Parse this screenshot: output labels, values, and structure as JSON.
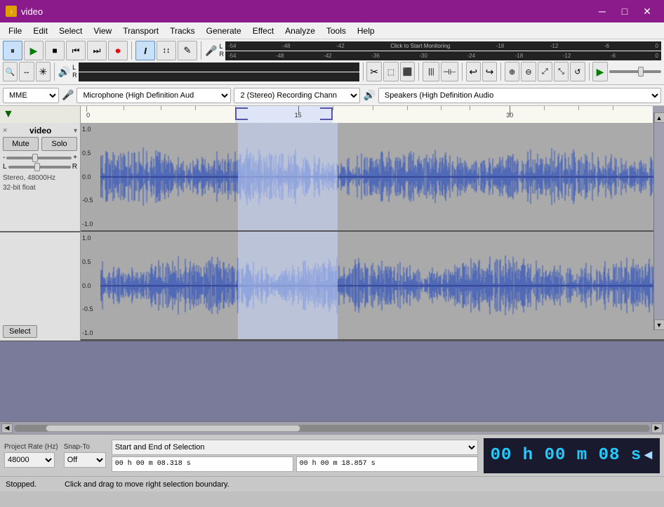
{
  "titlebar": {
    "icon": "♪",
    "title": "video",
    "min_btn": "─",
    "max_btn": "□",
    "close_btn": "✕"
  },
  "menu": {
    "items": [
      "File",
      "Edit",
      "Select",
      "View",
      "Transport",
      "Tracks",
      "Generate",
      "Effect",
      "Analyze",
      "Tools",
      "Help"
    ]
  },
  "toolbar": {
    "play_pause": "⏸",
    "play": "▶",
    "stop": "■",
    "skip_start": "⏮",
    "skip_end": "⏭",
    "record": "⏺",
    "select_tool": "I",
    "envelope_tool": "↕",
    "draw_tool": "✎",
    "mic_icon": "🎤",
    "zoom_in": "🔍",
    "zoom_out": "🔍",
    "zoom_fit": "⤢",
    "undo": "↩",
    "redo": "↪",
    "cut": "✂",
    "copy": "⿺",
    "paste": "📋"
  },
  "vu_meter": {
    "scale_values": [
      "-54",
      "-48",
      "-42",
      "-36",
      "-30",
      "-24",
      "-18",
      "-12",
      "-6",
      "0"
    ],
    "click_to_start": "Click to Start Monitoring",
    "lr1": "L",
    "lr2": "R"
  },
  "devices": {
    "host": "MME",
    "mic_icon": "🎤",
    "input": "Microphone (High Definition Aud",
    "channels": "2 (Stereo) Recording Chann",
    "speaker_icon": "🔊",
    "output": "Speakers (High Definition Audio"
  },
  "track": {
    "name": "video",
    "close": "×",
    "dropdown": "▾",
    "mute": "Mute",
    "solo": "Solo",
    "gain_minus": "-",
    "gain_plus": "+",
    "pan_l": "L",
    "pan_r": "R",
    "info_line1": "Stereo, 48000Hz",
    "info_line2": "32-bit float",
    "select_btn": "Select"
  },
  "timeline": {
    "start_arrow": "▼",
    "markers": [
      {
        "label": "0",
        "pct": 0
      },
      {
        "label": "15",
        "pct": 38
      },
      {
        "label": "30",
        "pct": 75
      }
    ]
  },
  "bottom": {
    "project_rate_label": "Project Rate (Hz)",
    "snap_to_label": "Snap-To",
    "rate_value": "48000",
    "snap_value": "Off",
    "selection_label": "Start and End of Selection",
    "selection_dropdown": "Start and End of Selection",
    "time_start": "00 h 00 m 08.318 s",
    "time_end": "00 h 00 m 18.857 s",
    "big_timer": "00 h 00 m 08 s",
    "big_timer_arrow": "◀"
  },
  "statusbar": {
    "left": "Stopped.",
    "right": "Click and drag to move right selection boundary."
  }
}
